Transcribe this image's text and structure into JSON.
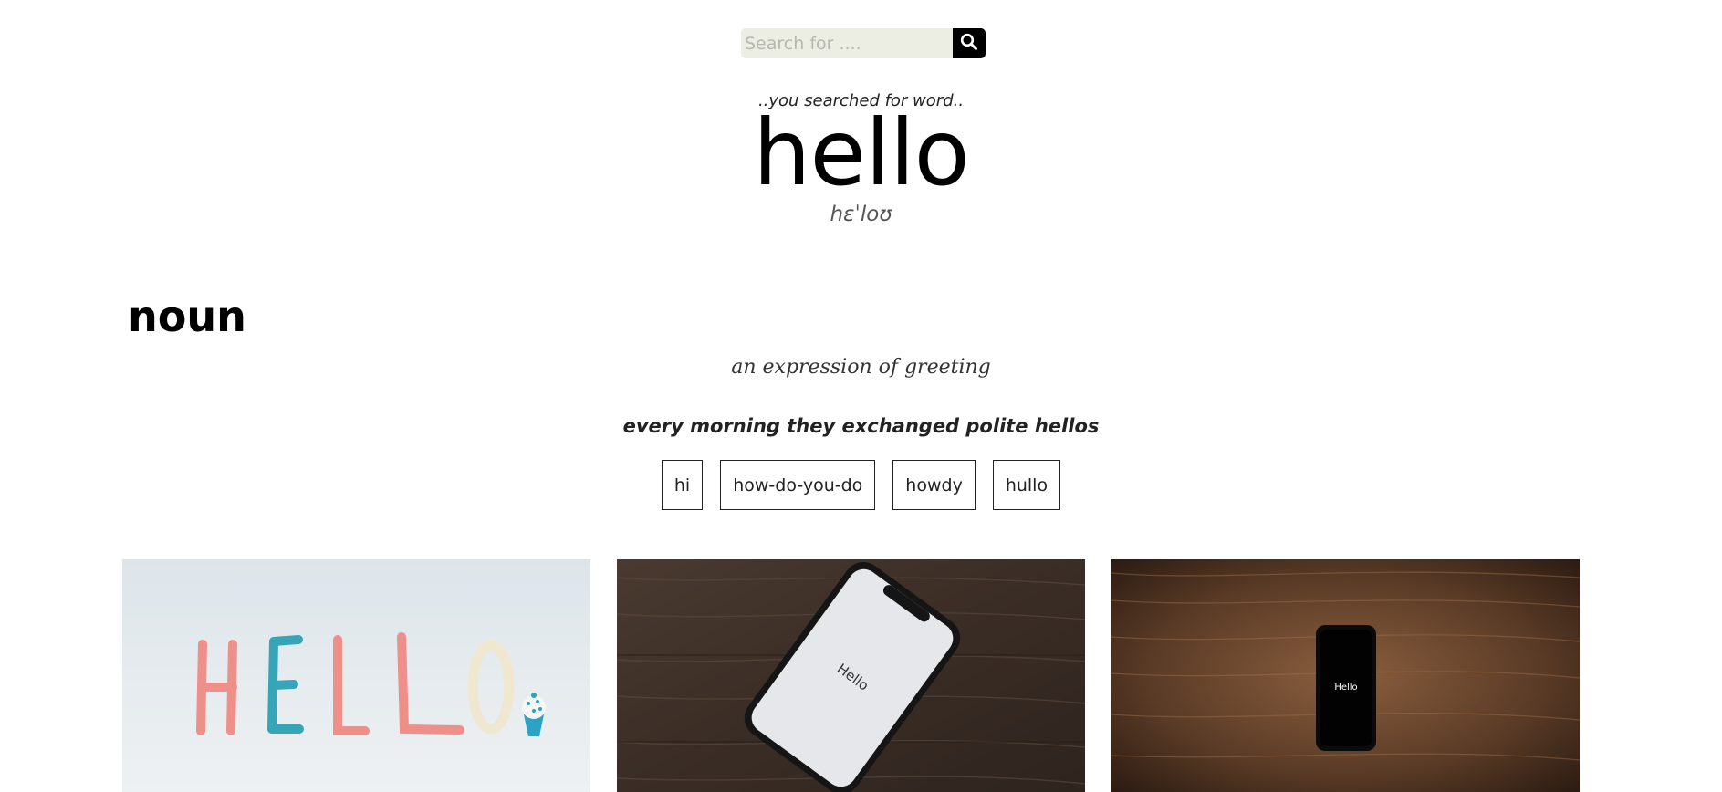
{
  "search": {
    "placeholder": "Search for ....",
    "value": ""
  },
  "result": {
    "kicker": "..you searched for word..",
    "word": "hello",
    "phonetic": "hɛˈloʊ"
  },
  "meaning": {
    "part_of_speech": "noun",
    "definition": "an expression of greeting",
    "example": "every morning they exchanged polite hellos",
    "synonyms": [
      "hi",
      "how-do-you-do",
      "howdy",
      "hullo"
    ]
  },
  "images": [
    {
      "icon": "hello-clay-letters-image",
      "text": "HELLO"
    },
    {
      "icon": "phone-hello-image",
      "text": "Hello"
    },
    {
      "icon": "phone-hello-dark-image",
      "text": "Hello"
    }
  ],
  "colors": {
    "search_bg": "#eceee4",
    "search_button": "#000000",
    "wood_dark": "#3a2c22",
    "wood_warm": "#5a3d28"
  }
}
